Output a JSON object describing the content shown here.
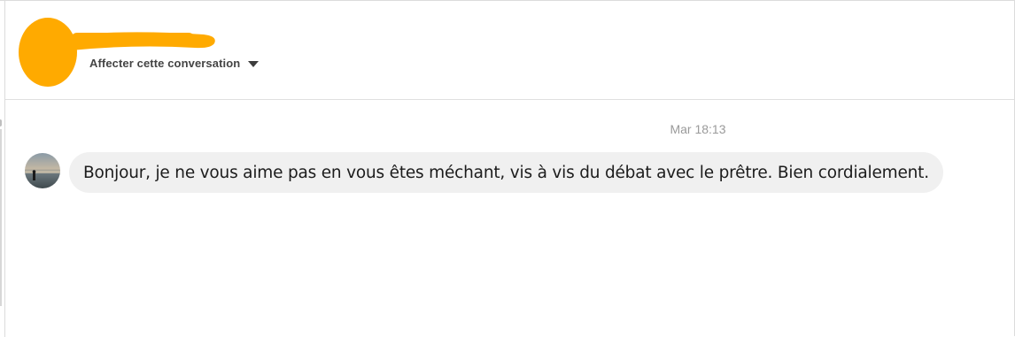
{
  "header": {
    "assign_label": "Affecter cette conversation",
    "redaction_color": "#FFAA00"
  },
  "conversation": {
    "messages": [
      {
        "timestamp": "Mar 18:13",
        "text": "Bonjour, je ne vous aime pas en vous êtes méchant, vis à vis du débat avec le prêtre. Bien cordialement."
      }
    ]
  },
  "icons": {
    "assign_dropdown": "caret-down-icon"
  }
}
